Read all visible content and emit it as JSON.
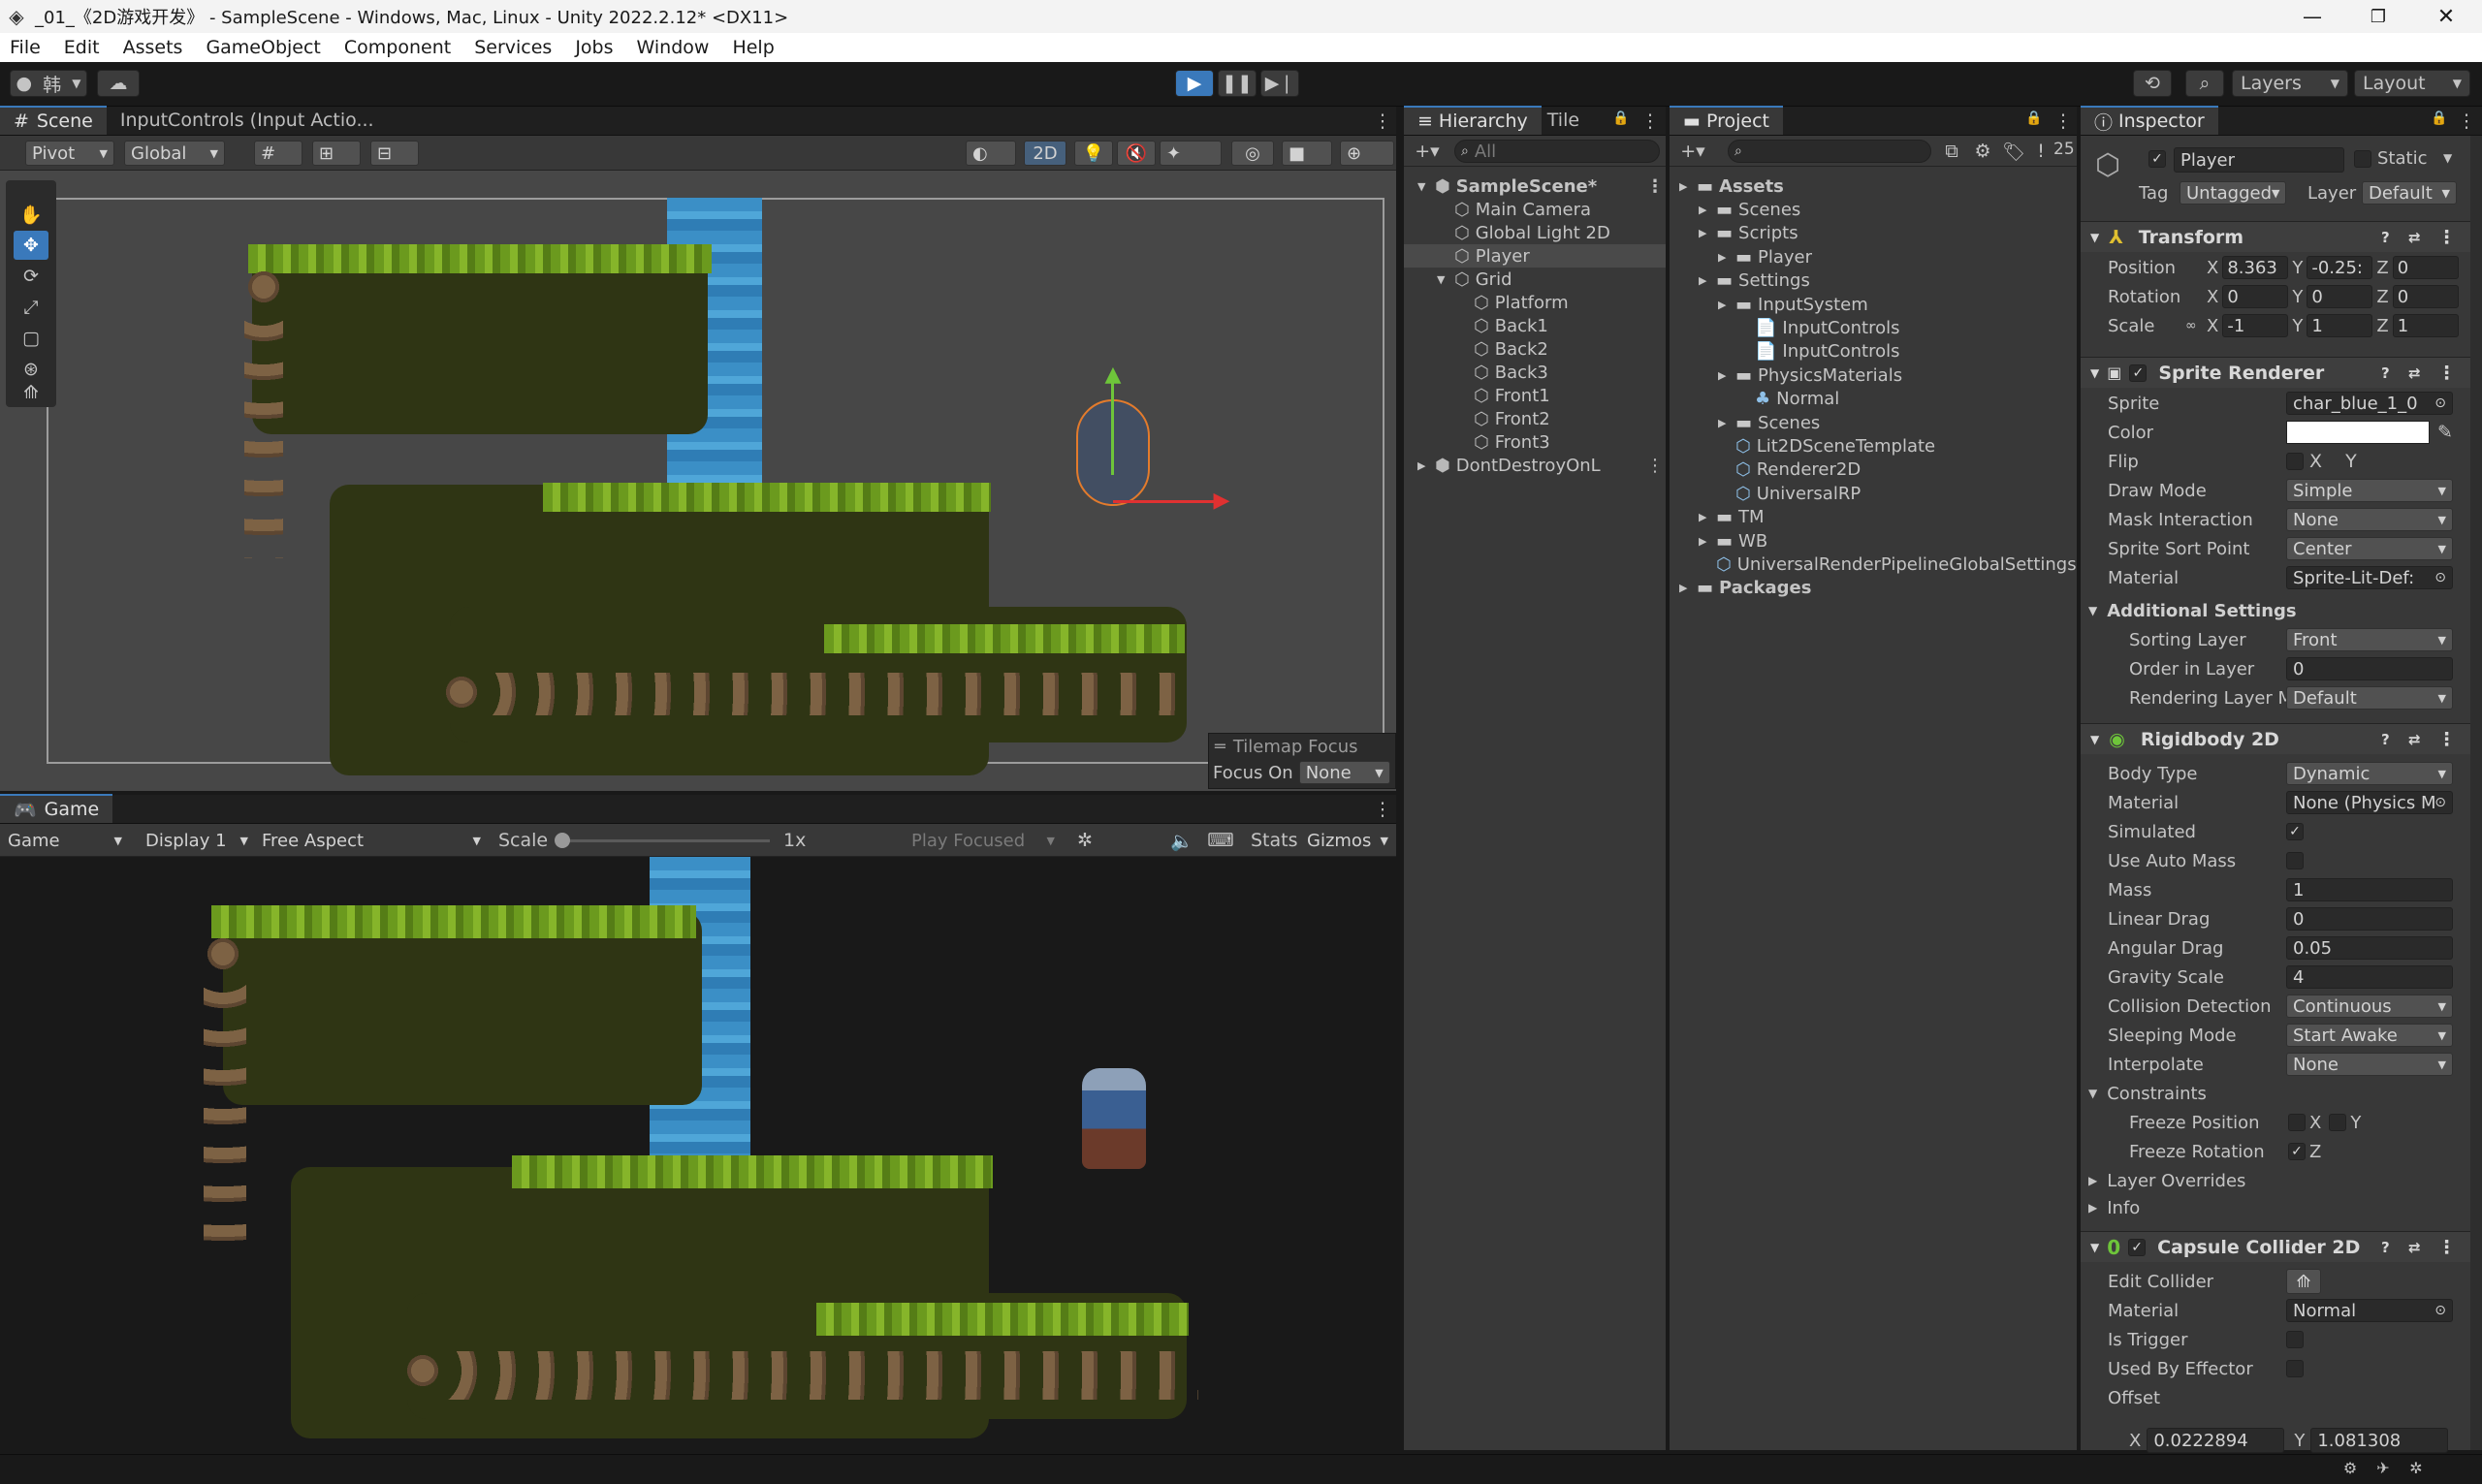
{
  "window": {
    "title": "_01_《2D游戏开发》 - SampleScene - Windows, Mac, Linux - Unity 2022.2.12* <DX11>"
  },
  "menu": [
    "File",
    "Edit",
    "Assets",
    "GameObject",
    "Component",
    "Services",
    "Jobs",
    "Window",
    "Help"
  ],
  "toolbar": {
    "account_label": "韩",
    "layers_label": "Layers",
    "layout_label": "Layout"
  },
  "scene": {
    "tab": "Scene",
    "tab2": "InputControls (Input Actio...",
    "pivot": "Pivot",
    "global": "Global",
    "mode2d": "2D",
    "tilemap_focus": "Tilemap Focus",
    "focus_on": "Focus On",
    "focus_value": "None"
  },
  "game": {
    "tab": "Game",
    "mode": "Game",
    "display": "Display 1",
    "aspect": "Free Aspect",
    "scale_label": "Scale",
    "scale_value": "1x",
    "play_focused": "Play Focused",
    "stats": "Stats",
    "gizmos": "Gizmos"
  },
  "hierarchy": {
    "tab": "Hierarchy",
    "tab2": "Tile",
    "search_placeholder": "All",
    "items": [
      {
        "label": "SampleScene*",
        "depth": 0,
        "bold": true
      },
      {
        "label": "Main Camera",
        "depth": 1
      },
      {
        "label": "Global Light 2D",
        "depth": 1
      },
      {
        "label": "Player",
        "depth": 1,
        "selected": true
      },
      {
        "label": "Grid",
        "depth": 1
      },
      {
        "label": "Platform",
        "depth": 2
      },
      {
        "label": "Back1",
        "depth": 2
      },
      {
        "label": "Back2",
        "depth": 2
      },
      {
        "label": "Back3",
        "depth": 2
      },
      {
        "label": "Front1",
        "depth": 2
      },
      {
        "label": "Front2",
        "depth": 2
      },
      {
        "label": "Front3",
        "depth": 2
      },
      {
        "label": "DontDestroyOnL",
        "depth": 0
      }
    ]
  },
  "project": {
    "tab": "Project",
    "hidden_count": "25",
    "items": [
      {
        "label": "Assets",
        "depth": 0,
        "bold": true
      },
      {
        "label": "Scenes",
        "depth": 1
      },
      {
        "label": "Scripts",
        "depth": 1
      },
      {
        "label": "Player",
        "depth": 2
      },
      {
        "label": "Settings",
        "depth": 1
      },
      {
        "label": "InputSystem",
        "depth": 2
      },
      {
        "label": "InputControls",
        "depth": 3
      },
      {
        "label": "InputControls",
        "depth": 3
      },
      {
        "label": "PhysicsMaterials",
        "depth": 2
      },
      {
        "label": "Normal",
        "depth": 3
      },
      {
        "label": "Scenes",
        "depth": 2
      },
      {
        "label": "Lit2DSceneTemplate",
        "depth": 2
      },
      {
        "label": "Renderer2D",
        "depth": 2
      },
      {
        "label": "UniversalRP",
        "depth": 2
      },
      {
        "label": "TM",
        "depth": 1
      },
      {
        "label": "WB",
        "depth": 1
      },
      {
        "label": "UniversalRenderPipelineGlobalSettings",
        "depth": 1
      },
      {
        "label": "Packages",
        "depth": 0,
        "bold": true
      }
    ]
  },
  "inspector": {
    "tab": "Inspector",
    "object_name": "Player",
    "static_label": "Static",
    "tag_label": "Tag",
    "tag_value": "Untagged",
    "layer_label": "Layer",
    "layer_value": "Default",
    "transform": {
      "title": "Transform",
      "position": {
        "label": "Position",
        "x": "8.363",
        "y": "-0.25:",
        "z": "0"
      },
      "rotation": {
        "label": "Rotation",
        "x": "0",
        "y": "0",
        "z": "0"
      },
      "scale": {
        "label": "Scale",
        "x": "-1",
        "y": "1",
        "z": "1"
      }
    },
    "sprite_renderer": {
      "title": "Sprite Renderer",
      "rows": [
        {
          "label": "Sprite",
          "value": "char_blue_1_0"
        },
        {
          "label": "Color",
          "value": ""
        },
        {
          "label": "Flip",
          "value": "X    Y"
        },
        {
          "label": "Draw Mode",
          "value": "Simple"
        },
        {
          "label": "Mask Interaction",
          "value": "None"
        },
        {
          "label": "Sprite Sort Point",
          "value": "Center"
        },
        {
          "label": "Material",
          "value": "Sprite-Lit-Def:"
        }
      ],
      "additional": "Additional Settings",
      "sub_rows": [
        {
          "label": "Sorting Layer",
          "value": "Front"
        },
        {
          "label": "Order in Layer",
          "value": "0"
        },
        {
          "label": "Rendering Layer M",
          "value": "Default"
        }
      ]
    },
    "rigidbody": {
      "title": "Rigidbody 2D",
      "rows": [
        {
          "label": "Body Type",
          "value": "Dynamic"
        },
        {
          "label": "Material",
          "value": "None (Physics M"
        },
        {
          "label": "Simulated",
          "value": "✓"
        },
        {
          "label": "Use Auto Mass",
          "value": ""
        },
        {
          "label": "Mass",
          "value": "1"
        },
        {
          "label": "Linear Drag",
          "value": "0"
        },
        {
          "label": "Angular Drag",
          "value": "0.05"
        },
        {
          "label": "Gravity Scale",
          "value": "4"
        },
        {
          "label": "Collision Detection",
          "value": "Continuous"
        },
        {
          "label": "Sleeping Mode",
          "value": "Start Awake"
        },
        {
          "label": "Interpolate",
          "value": "None"
        }
      ],
      "constraints": "Constraints",
      "freeze_position": "Freeze Position",
      "freeze_rotation": "Freeze Rotation",
      "layer_overrides": "Layer Overrides",
      "info": "Info"
    },
    "capsule": {
      "title": "Capsule Collider 2D",
      "rows": [
        {
          "label": "Edit Collider",
          "value": ""
        },
        {
          "label": "Material",
          "value": "Normal"
        },
        {
          "label": "Is Trigger",
          "value": ""
        },
        {
          "label": "Used By Effector",
          "value": ""
        },
        {
          "label": "Offset",
          "value": ""
        }
      ],
      "offset_x": "0.0222894",
      "offset_y": "1.081308"
    }
  },
  "colors": {
    "accent": "#3a79bb",
    "selection": "#2c5d87",
    "play": "#3a79bb"
  }
}
